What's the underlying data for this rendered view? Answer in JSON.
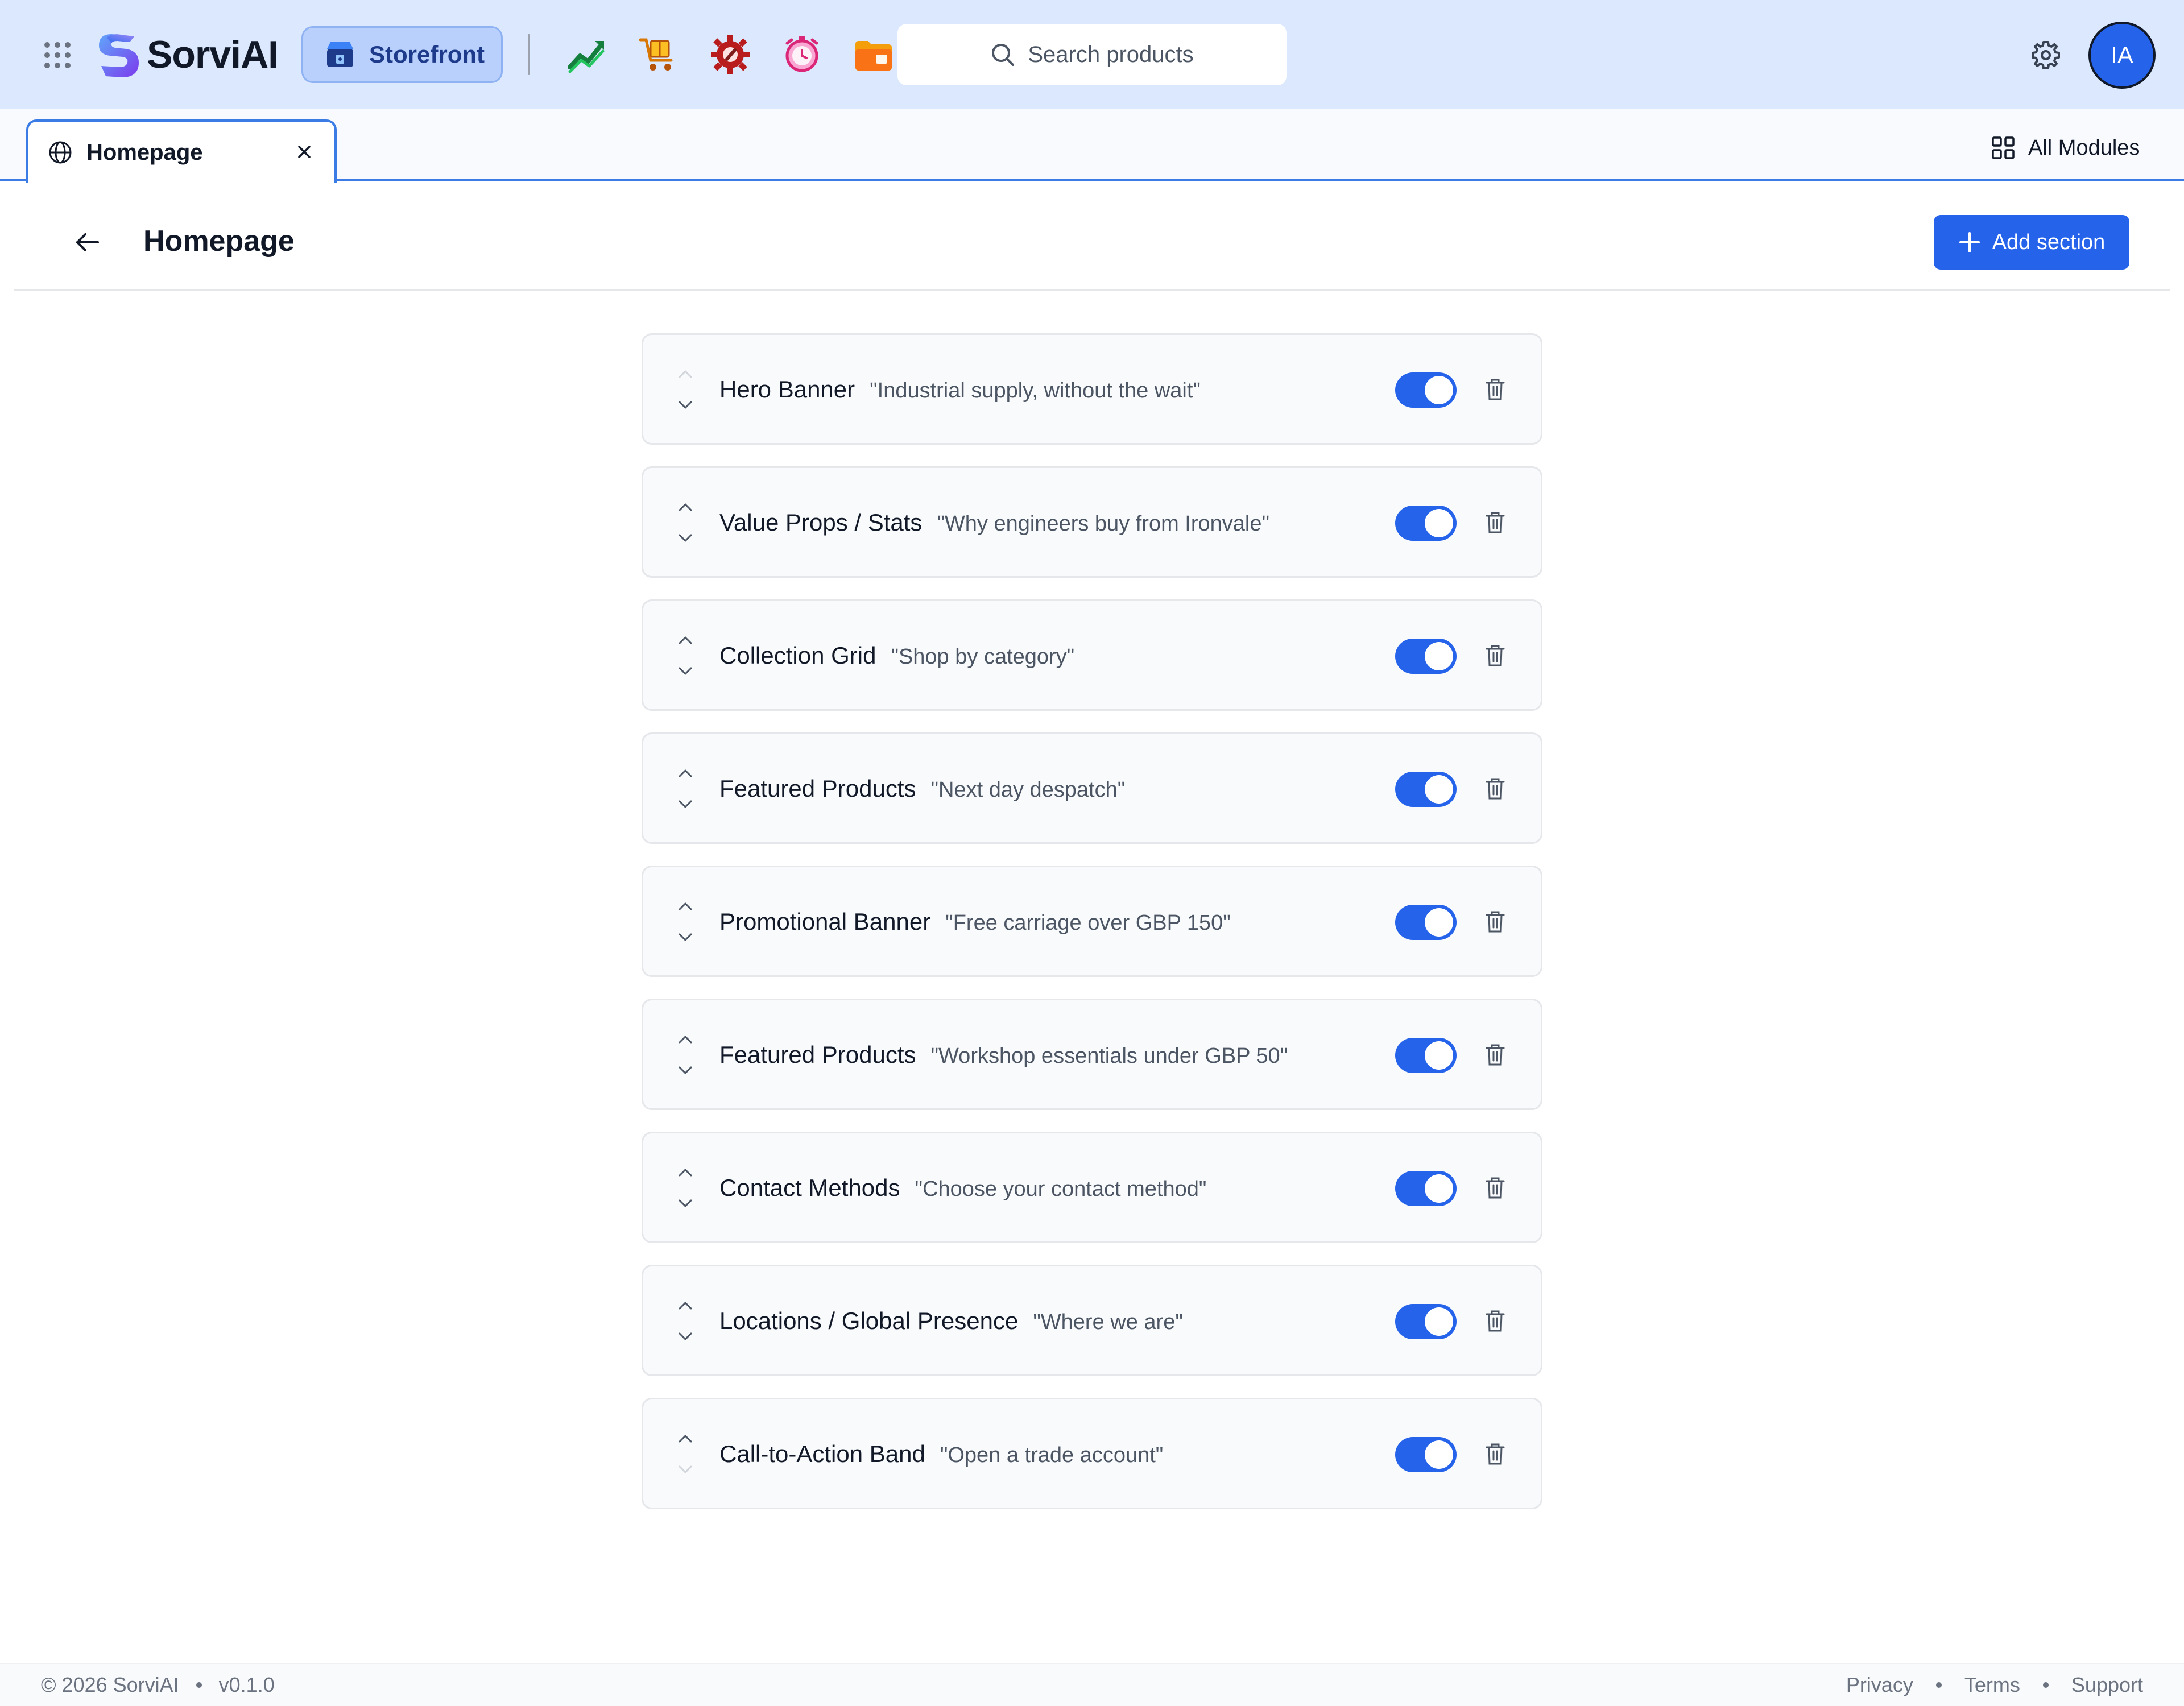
{
  "app": {
    "brand": "SorviAI",
    "current_module": "Storefront"
  },
  "topbar": {
    "module_icons": [
      "analytics-icon",
      "procurement-icon",
      "service-icon",
      "timekeeping-icon",
      "files-icon"
    ],
    "search_placeholder": "Search products",
    "user_initials": "IA"
  },
  "tabs": [
    {
      "label": "Homepage",
      "icon": "globe-icon",
      "active": true
    }
  ],
  "all_modules_label": "All Modules",
  "page": {
    "title": "Homepage",
    "add_button_label": "Add section"
  },
  "sections": [
    {
      "name": "Hero Banner",
      "subtitle": "\"Industrial supply, without the wait\"",
      "enabled": true
    },
    {
      "name": "Value Props / Stats",
      "subtitle": "\"Why engineers buy from Ironvale\"",
      "enabled": true
    },
    {
      "name": "Collection Grid",
      "subtitle": "\"Shop by category\"",
      "enabled": true
    },
    {
      "name": "Featured Products",
      "subtitle": "\"Next day despatch\"",
      "enabled": true
    },
    {
      "name": "Promotional Banner",
      "subtitle": "\"Free carriage over GBP 150\"",
      "enabled": true
    },
    {
      "name": "Featured Products",
      "subtitle": "\"Workshop essentials under GBP 50\"",
      "enabled": true
    },
    {
      "name": "Contact Methods",
      "subtitle": "\"Choose your contact method\"",
      "enabled": true
    },
    {
      "name": "Locations / Global Presence",
      "subtitle": "\"Where we are\"",
      "enabled": true
    },
    {
      "name": "Call-to-Action Band",
      "subtitle": "\"Open a trade account\"",
      "enabled": true
    }
  ],
  "footer": {
    "copyright": "© 2026 SorviAI",
    "version": "v0.1.0",
    "links": [
      "Privacy",
      "Terms",
      "Support"
    ]
  },
  "colors": {
    "accent": "#2563eb",
    "topbar_bg": "#dbe8fd",
    "tab_border": "#3b7be5"
  }
}
